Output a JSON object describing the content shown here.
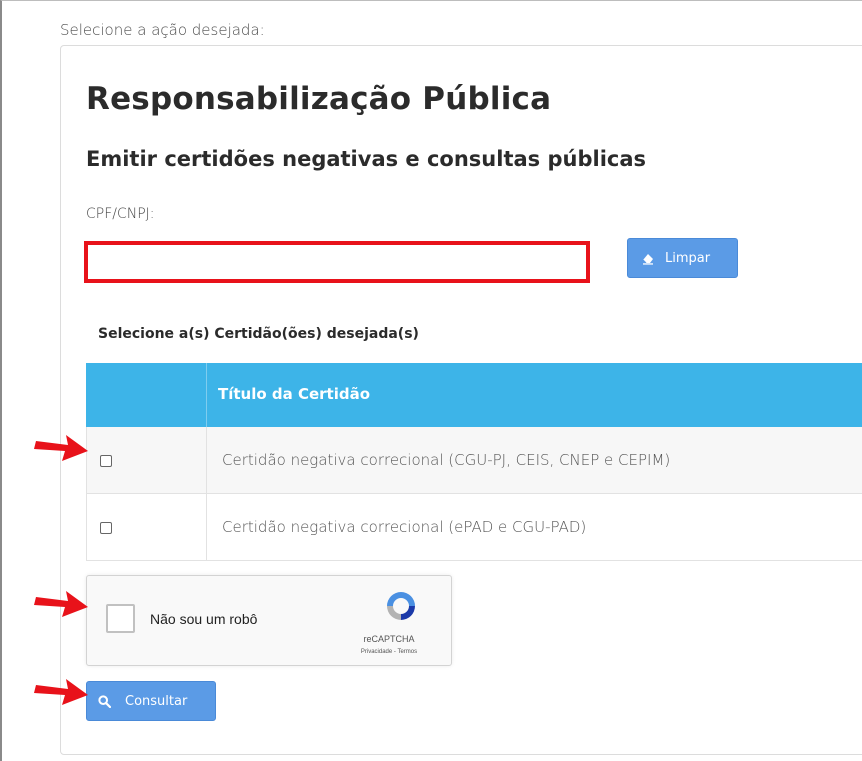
{
  "prompt": "Selecione a ação desejada:",
  "page": {
    "title": "Responsabilização Pública",
    "subtitle": "Emitir certidões negativas e consultas públicas"
  },
  "form": {
    "cpf_label": "CPF/CNPJ:",
    "cpf_value": "",
    "clear_button_label": "Limpar",
    "clear_icon": "eraser-icon"
  },
  "certificates": {
    "section_title": "Selecione a(s) Certidão(ões) desejada(s)",
    "column_header": "Título da Certidão",
    "rows": [
      {
        "label": "Certidão negativa correcional (CGU-PJ, CEIS, CNEP e CEPIM)",
        "checked": false
      },
      {
        "label": "Certidão negativa correcional (ePAD e CGU-PAD)",
        "checked": false
      }
    ]
  },
  "captcha": {
    "label": "Não sou um robô",
    "brand": "reCAPTCHA",
    "links": "Privacidade - Termos",
    "checked": false
  },
  "submit": {
    "label": "Consultar",
    "icon": "search-icon"
  },
  "colors": {
    "primary_button": "#5b9be6",
    "table_header": "#3db4e8",
    "highlight": "#e8121a",
    "arrow": "#e8121a"
  }
}
